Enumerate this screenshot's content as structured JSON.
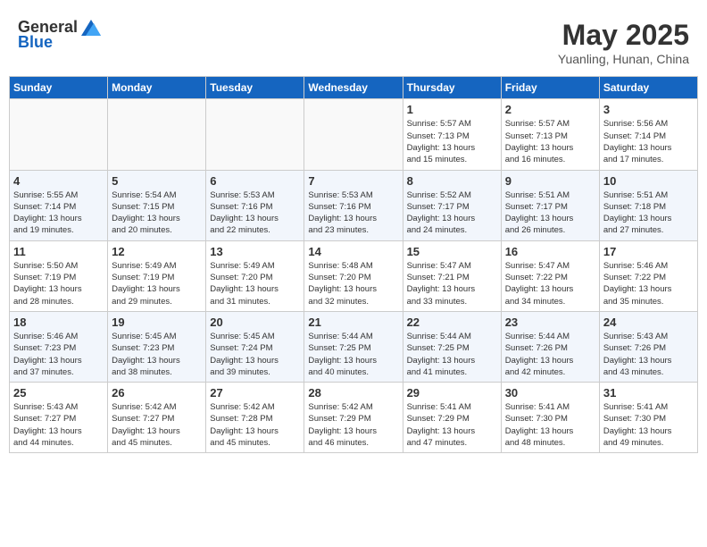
{
  "header": {
    "logo_general": "General",
    "logo_blue": "Blue",
    "title": "May 2025",
    "subtitle": "Yuanling, Hunan, China"
  },
  "weekdays": [
    "Sunday",
    "Monday",
    "Tuesday",
    "Wednesday",
    "Thursday",
    "Friday",
    "Saturday"
  ],
  "weeks": [
    [
      {
        "day": "",
        "info": ""
      },
      {
        "day": "",
        "info": ""
      },
      {
        "day": "",
        "info": ""
      },
      {
        "day": "",
        "info": ""
      },
      {
        "day": "1",
        "info": "Sunrise: 5:57 AM\nSunset: 7:13 PM\nDaylight: 13 hours\nand 15 minutes."
      },
      {
        "day": "2",
        "info": "Sunrise: 5:57 AM\nSunset: 7:13 PM\nDaylight: 13 hours\nand 16 minutes."
      },
      {
        "day": "3",
        "info": "Sunrise: 5:56 AM\nSunset: 7:14 PM\nDaylight: 13 hours\nand 17 minutes."
      }
    ],
    [
      {
        "day": "4",
        "info": "Sunrise: 5:55 AM\nSunset: 7:14 PM\nDaylight: 13 hours\nand 19 minutes."
      },
      {
        "day": "5",
        "info": "Sunrise: 5:54 AM\nSunset: 7:15 PM\nDaylight: 13 hours\nand 20 minutes."
      },
      {
        "day": "6",
        "info": "Sunrise: 5:53 AM\nSunset: 7:16 PM\nDaylight: 13 hours\nand 22 minutes."
      },
      {
        "day": "7",
        "info": "Sunrise: 5:53 AM\nSunset: 7:16 PM\nDaylight: 13 hours\nand 23 minutes."
      },
      {
        "day": "8",
        "info": "Sunrise: 5:52 AM\nSunset: 7:17 PM\nDaylight: 13 hours\nand 24 minutes."
      },
      {
        "day": "9",
        "info": "Sunrise: 5:51 AM\nSunset: 7:17 PM\nDaylight: 13 hours\nand 26 minutes."
      },
      {
        "day": "10",
        "info": "Sunrise: 5:51 AM\nSunset: 7:18 PM\nDaylight: 13 hours\nand 27 minutes."
      }
    ],
    [
      {
        "day": "11",
        "info": "Sunrise: 5:50 AM\nSunset: 7:19 PM\nDaylight: 13 hours\nand 28 minutes."
      },
      {
        "day": "12",
        "info": "Sunrise: 5:49 AM\nSunset: 7:19 PM\nDaylight: 13 hours\nand 29 minutes."
      },
      {
        "day": "13",
        "info": "Sunrise: 5:49 AM\nSunset: 7:20 PM\nDaylight: 13 hours\nand 31 minutes."
      },
      {
        "day": "14",
        "info": "Sunrise: 5:48 AM\nSunset: 7:20 PM\nDaylight: 13 hours\nand 32 minutes."
      },
      {
        "day": "15",
        "info": "Sunrise: 5:47 AM\nSunset: 7:21 PM\nDaylight: 13 hours\nand 33 minutes."
      },
      {
        "day": "16",
        "info": "Sunrise: 5:47 AM\nSunset: 7:22 PM\nDaylight: 13 hours\nand 34 minutes."
      },
      {
        "day": "17",
        "info": "Sunrise: 5:46 AM\nSunset: 7:22 PM\nDaylight: 13 hours\nand 35 minutes."
      }
    ],
    [
      {
        "day": "18",
        "info": "Sunrise: 5:46 AM\nSunset: 7:23 PM\nDaylight: 13 hours\nand 37 minutes."
      },
      {
        "day": "19",
        "info": "Sunrise: 5:45 AM\nSunset: 7:23 PM\nDaylight: 13 hours\nand 38 minutes."
      },
      {
        "day": "20",
        "info": "Sunrise: 5:45 AM\nSunset: 7:24 PM\nDaylight: 13 hours\nand 39 minutes."
      },
      {
        "day": "21",
        "info": "Sunrise: 5:44 AM\nSunset: 7:25 PM\nDaylight: 13 hours\nand 40 minutes."
      },
      {
        "day": "22",
        "info": "Sunrise: 5:44 AM\nSunset: 7:25 PM\nDaylight: 13 hours\nand 41 minutes."
      },
      {
        "day": "23",
        "info": "Sunrise: 5:44 AM\nSunset: 7:26 PM\nDaylight: 13 hours\nand 42 minutes."
      },
      {
        "day": "24",
        "info": "Sunrise: 5:43 AM\nSunset: 7:26 PM\nDaylight: 13 hours\nand 43 minutes."
      }
    ],
    [
      {
        "day": "25",
        "info": "Sunrise: 5:43 AM\nSunset: 7:27 PM\nDaylight: 13 hours\nand 44 minutes."
      },
      {
        "day": "26",
        "info": "Sunrise: 5:42 AM\nSunset: 7:27 PM\nDaylight: 13 hours\nand 45 minutes."
      },
      {
        "day": "27",
        "info": "Sunrise: 5:42 AM\nSunset: 7:28 PM\nDaylight: 13 hours\nand 45 minutes."
      },
      {
        "day": "28",
        "info": "Sunrise: 5:42 AM\nSunset: 7:29 PM\nDaylight: 13 hours\nand 46 minutes."
      },
      {
        "day": "29",
        "info": "Sunrise: 5:41 AM\nSunset: 7:29 PM\nDaylight: 13 hours\nand 47 minutes."
      },
      {
        "day": "30",
        "info": "Sunrise: 5:41 AM\nSunset: 7:30 PM\nDaylight: 13 hours\nand 48 minutes."
      },
      {
        "day": "31",
        "info": "Sunrise: 5:41 AM\nSunset: 7:30 PM\nDaylight: 13 hours\nand 49 minutes."
      }
    ]
  ]
}
